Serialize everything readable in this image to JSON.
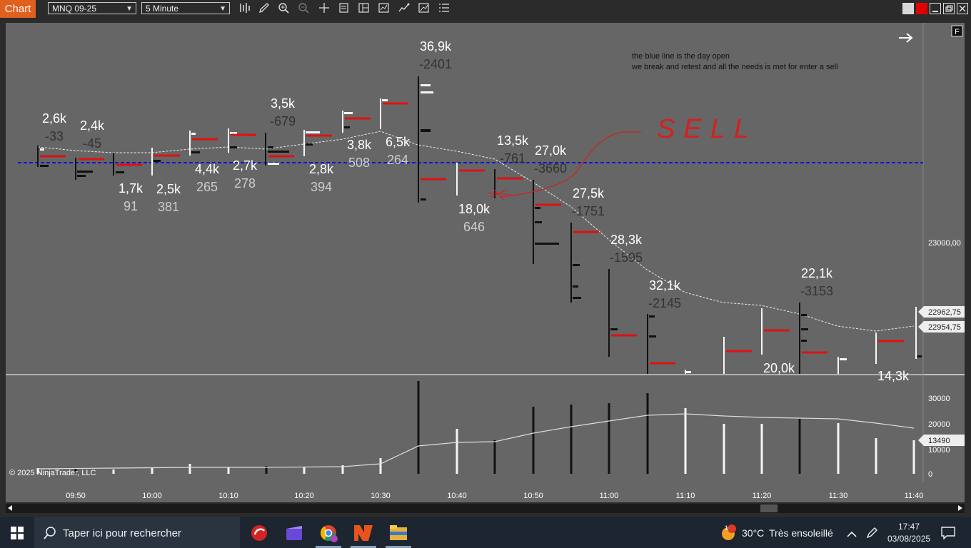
{
  "toolbar": {
    "tab_label": "Chart",
    "instrument": "MNQ 09-25",
    "interval": "5 Minute"
  },
  "chart": {
    "price_level_labels": [
      "22962,75",
      "22954,75"
    ],
    "price_axis": [
      "23000,00"
    ],
    "volume_axis": [
      "30000",
      "20000",
      "10000",
      "0"
    ],
    "volume_current_label": "13490",
    "time_axis": [
      "09:50",
      "10:00",
      "10:10",
      "10:20",
      "10:30",
      "10:40",
      "10:50",
      "11:00",
      "11:10",
      "11:20",
      "11:30",
      "11:40"
    ],
    "copyright": "© 2025 NinjaTrader, LLC",
    "annotation_line1": "the blue line is the day open",
    "annotation_line2": "we break and retest and all the needs is met for enter a sell",
    "sell_label": "SELL",
    "f_badge": "F",
    "bar_stats": [
      {
        "vol": "2,6k",
        "delta": "-33"
      },
      {
        "vol": "2,4k",
        "delta": "-45"
      },
      {
        "vol": "1,7k",
        "delta": "91"
      },
      {
        "vol": "2,5k",
        "delta": "381"
      },
      {
        "vol": "4,4k",
        "delta": "265"
      },
      {
        "vol": "2,7k",
        "delta": "278"
      },
      {
        "vol": "3,5k",
        "delta": "-679"
      },
      {
        "vol": "2,8k",
        "delta": "394"
      },
      {
        "vol": "3,8k",
        "delta": "508"
      },
      {
        "vol": "6,5k",
        "delta": "264"
      },
      {
        "vol": "36,9k",
        "delta": "-2401"
      },
      {
        "vol": "18,0k",
        "delta": "646"
      },
      {
        "vol": "13,5k",
        "delta": "-761"
      },
      {
        "vol": "27,0k",
        "delta": "-3660"
      },
      {
        "vol": "27,5k",
        "delta": "-1751"
      },
      {
        "vol": "28,3k",
        "delta": "-1595"
      },
      {
        "vol": "32,1k",
        "delta": "-2145"
      },
      {
        "vol": "22,1k",
        "delta": "-3153"
      },
      {
        "vol": "20,0k",
        "delta": ""
      },
      {
        "vol": "14,3k",
        "delta": ""
      }
    ]
  },
  "taskbar": {
    "search_placeholder": "Taper ici pour rechercher",
    "weather_temp": "30°C",
    "weather_desc": "Très ensoleillé",
    "time": "17:47",
    "date": "03/08/2025",
    "notification_badge": "1"
  },
  "colors": {
    "accent": "#e0601d",
    "day_open_line": "#0a18d8",
    "poc_line": "#e01010",
    "annotation_red": "#d42020"
  }
}
